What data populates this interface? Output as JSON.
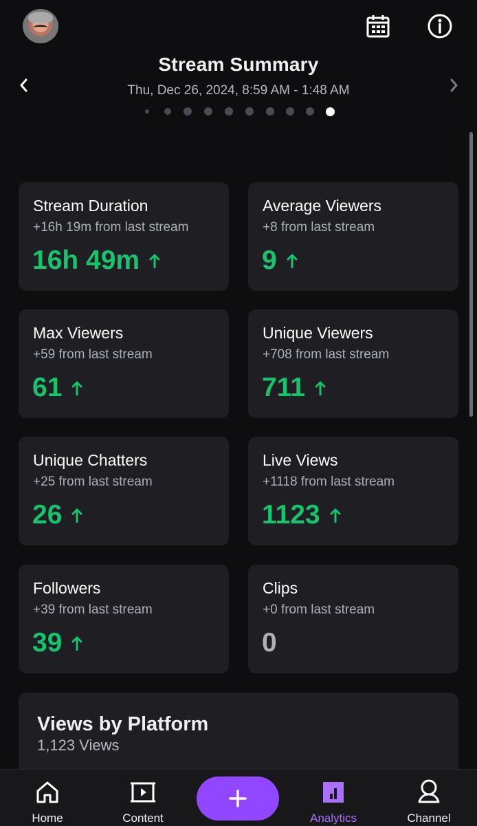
{
  "header": {
    "title": "Stream Summary",
    "date_range": "Thu, Dec 26, 2024, 8:59 AM - 1:48 AM",
    "page_dots": {
      "count": 10,
      "active_index": 9
    }
  },
  "colors": {
    "background": "#0e0e10",
    "card": "#1f1f23",
    "positive": "#18c36e",
    "accent": "#9147ff",
    "muted": "#aeb0b8"
  },
  "icons": {
    "avatar": "profile-avatar",
    "calendar": "calendar-icon",
    "info": "info-icon",
    "previous": "chevron-left-icon",
    "next": "chevron-right-icon",
    "trend": "arrow-up-icon"
  },
  "stats": [
    {
      "title": "Stream Duration",
      "change": "+16h 19m from last stream",
      "value": "16h 49m",
      "trend": "up"
    },
    {
      "title": "Average Viewers",
      "change": "+8 from last stream",
      "value": "9",
      "trend": "up"
    },
    {
      "title": "Max Viewers",
      "change": "+59 from last stream",
      "value": "61",
      "trend": "up"
    },
    {
      "title": "Unique Viewers",
      "change": "+708 from last stream",
      "value": "711",
      "trend": "up"
    },
    {
      "title": "Unique Chatters",
      "change": "+25 from last stream",
      "value": "26",
      "trend": "up"
    },
    {
      "title": "Live Views",
      "change": "+1118 from last stream",
      "value": "1123",
      "trend": "up"
    },
    {
      "title": "Followers",
      "change": "+39 from last stream",
      "value": "39",
      "trend": "up"
    },
    {
      "title": "Clips",
      "change": "+0 from last stream",
      "value": "0",
      "trend": "none"
    }
  ],
  "platform": {
    "title": "Views by Platform",
    "views": "1,123 Views"
  },
  "bottom_nav": [
    {
      "label": "Home",
      "icon": "home-icon"
    },
    {
      "label": "Content",
      "icon": "content-icon"
    },
    {
      "label": "",
      "icon": "plus-icon"
    },
    {
      "label": "Analytics",
      "icon": "analytics-icon",
      "active": true
    },
    {
      "label": "Channel",
      "icon": "channel-icon"
    }
  ]
}
